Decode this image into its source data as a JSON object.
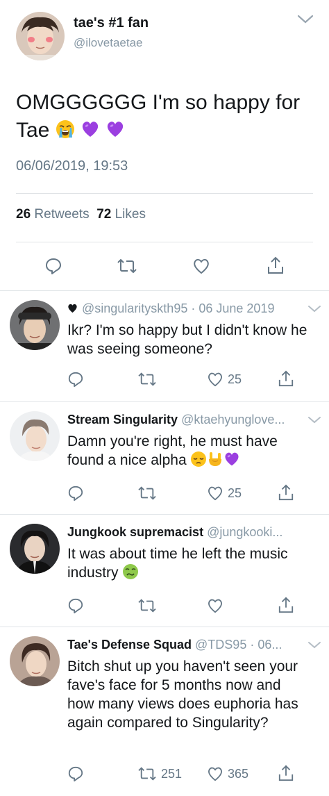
{
  "main_tweet": {
    "display_name": "tae's #1 fan",
    "handle": "@ilovetaetae",
    "text": "OMGGGGGG I'm so happy for Tae",
    "emojis": [
      "loudly-crying-face",
      "purple-heart",
      "purple-heart"
    ],
    "timestamp": "06/06/2019, 19:53",
    "retweets_count": "26",
    "retweets_label": "Retweets",
    "likes_count": "72",
    "likes_label": "Likes"
  },
  "replies": [
    {
      "display_name": "",
      "prefix_icon": "black-heart",
      "handle": "@singularityskth95",
      "date": "· 06 June 2019",
      "text": "Ikr? I'm so happy but I didn't know he was seeing someone?",
      "emojis": [],
      "retweets": "",
      "likes": "25"
    },
    {
      "display_name": "Stream Singularity",
      "handle": "@ktaehyunglove...",
      "date": "",
      "text": "Damn you're right, he must have found a nice alpha",
      "emojis": [
        "pensive-face",
        "sign-of-horns",
        "purple-heart"
      ],
      "retweets": "",
      "likes": "25"
    },
    {
      "display_name": "Jungkook supremacist",
      "handle": "@jungkooki...",
      "date": "",
      "text": "It was about time he left the music industry",
      "emojis": [
        "nauseated-face"
      ],
      "retweets": "",
      "likes": ""
    },
    {
      "display_name": "Tae's Defense Squad",
      "handle": "@TDS95",
      "date": "· 06...",
      "text": "Bitch shut up you haven't seen your fave's face for 5 months now and how many views does euphoria has again compared to Singularity?",
      "emojis": [],
      "retweets": "251",
      "likes": "365"
    }
  ],
  "colors": {
    "text": "#14171a",
    "secondary": "#657786",
    "handle": "#8899a6",
    "divider": "#e1e5e8",
    "purple_heart": "#9b3fe0"
  }
}
